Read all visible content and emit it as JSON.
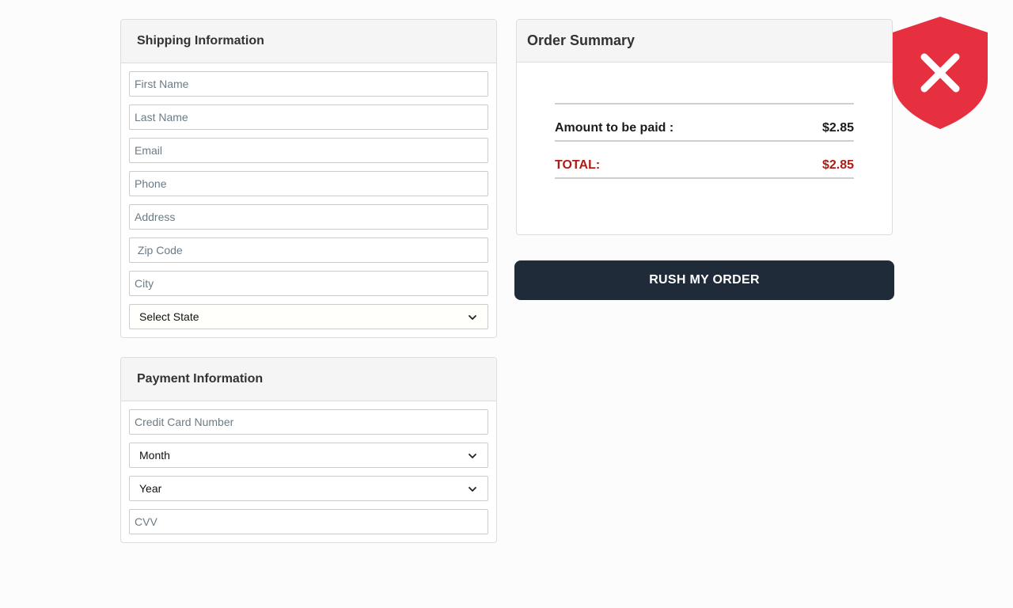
{
  "shipping": {
    "title": "Shipping Information",
    "first_name_placeholder": "First Name",
    "last_name_placeholder": "Last Name",
    "email_placeholder": "Email",
    "phone_placeholder": "Phone",
    "address_placeholder": "Address",
    "zip_placeholder": " Zip Code",
    "city_placeholder": "City",
    "state_select": "Select State"
  },
  "payment": {
    "title": "Payment Information",
    "card_placeholder": "Credit Card Number",
    "month_select": "Month",
    "year_select": "Year",
    "cvv_placeholder": "CVV"
  },
  "summary": {
    "title": "Order Summary",
    "amount_label": "Amount to be paid :",
    "amount_value": "$2.85",
    "total_label": "TOTAL:",
    "total_value": "$2.85"
  },
  "actions": {
    "rush_label": "RUSH MY ORDER"
  },
  "icons": {
    "shield": "shield-x-icon",
    "chevron": "chevron-down-icon"
  },
  "colors": {
    "button_bg": "#1f2b38",
    "total_red": "#b01b15",
    "shield_red": "#e7303f"
  }
}
